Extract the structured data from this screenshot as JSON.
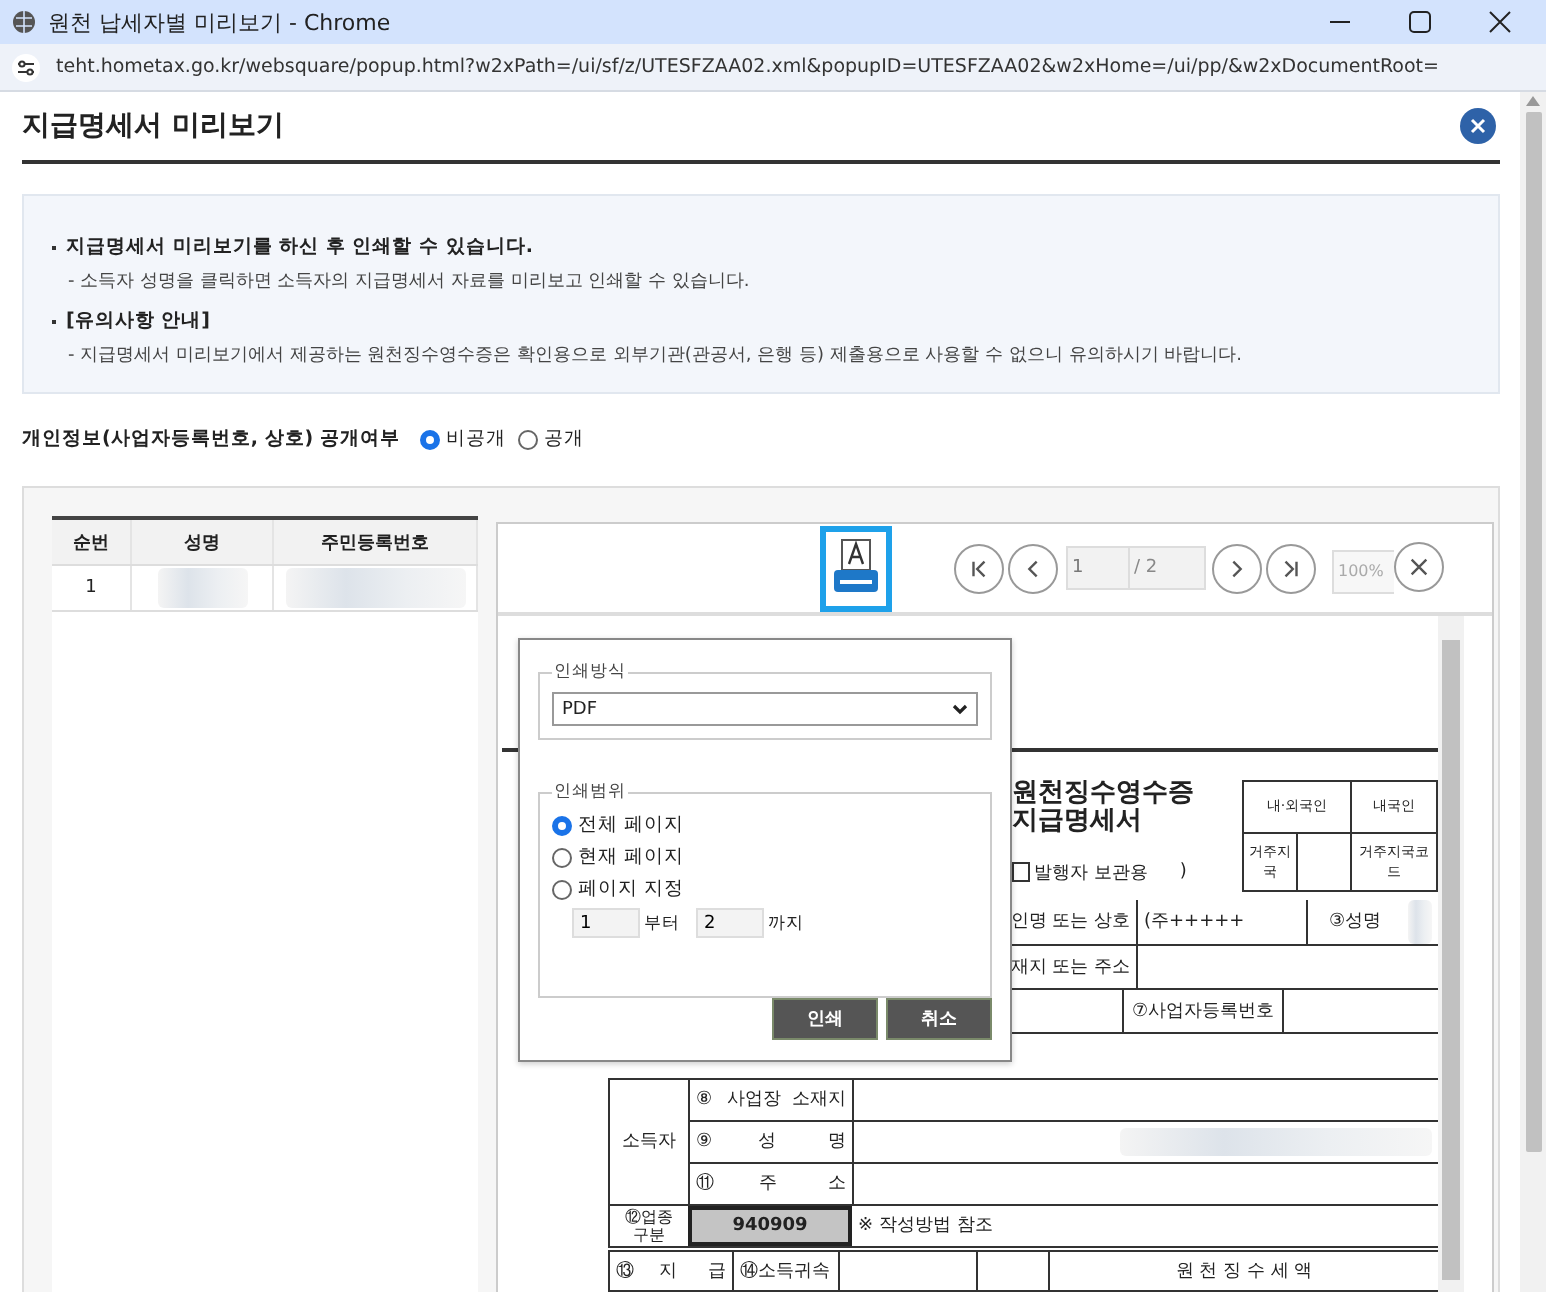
{
  "window": {
    "title": "원천 납세자별 미리보기 - Chrome",
    "url": "teht.hometax.go.kr/websquare/popup.html?w2xPath=/ui/sf/z/UTESFZAA02.xml&popupID=UTESFZAA02&w2xHome=/ui/pp/&w2xDocumentRoot="
  },
  "page": {
    "title": "지급명세서 미리보기"
  },
  "notices": [
    {
      "heading": "지급명세서 미리보기를 하신 후 인쇄할 수 있습니다.",
      "detail": "- 소득자 성명을 클릭하면 소득자의 지급명세서 자료를 미리보고 인쇄할 수 있습니다."
    },
    {
      "heading": "[유의사항 안내]",
      "detail": "- 지급명세서 미리보기에서 제공하는 원천징수영수증은 확인용으로 외부기관(관공서, 은행 등) 제출용으로 사용할 수 없으니 유의하시기 바랍니다."
    }
  ],
  "privacy": {
    "label": "개인정보(사업자등록번호, 상호) 공개여부",
    "options": [
      {
        "label": "비공개",
        "selected": true
      },
      {
        "label": "공개",
        "selected": false
      }
    ]
  },
  "list": {
    "columns": [
      "순번",
      "성명",
      "주민등록번호"
    ],
    "rows": [
      {
        "no": "1"
      }
    ]
  },
  "viewer": {
    "page": "1",
    "total": "/ 2",
    "zoom": "100%"
  },
  "print_dialog": {
    "method_label": "인쇄방식",
    "method": "PDF",
    "range_label": "인쇄범위",
    "ranges": [
      {
        "label": "전체 페이지",
        "selected": true
      },
      {
        "label": "현재 페이지",
        "selected": false
      },
      {
        "label": "페이지 지정",
        "selected": false
      }
    ],
    "from": "1",
    "from_label": "부터",
    "to": "2",
    "to_label": "까지",
    "buttons": [
      "인쇄",
      "취소"
    ]
  },
  "document": {
    "title_lines": [
      "원천징수영수증",
      "지급명세서"
    ],
    "copy": {
      "label": "발행자 보관용",
      "checked": false,
      "close": ")"
    },
    "residency": [
      "내·외국인",
      "내국인",
      "거주지국",
      "거주지국코드"
    ],
    "payer_rows": [
      {
        "label": "인명 또는 상호",
        "value": "(주+++++",
        "extra": "③성명"
      },
      {
        "label": "재지 또는 주소",
        "value": "",
        "extra": ""
      }
    ],
    "payer_reg_label": "⑦사업자등록번호",
    "earner": {
      "label": "소득자",
      "rows": [
        "⑧ 사업장 소재지",
        "⑨성 명",
        "⑪주 소"
      ]
    },
    "industry": {
      "label": "⑫업종 구분",
      "code": "940909",
      "note": "※ 작성방법 참조"
    },
    "payment_headers": [
      "⑬지 급",
      "⑭소득귀속",
      "원 천 징 수 세 액"
    ]
  }
}
